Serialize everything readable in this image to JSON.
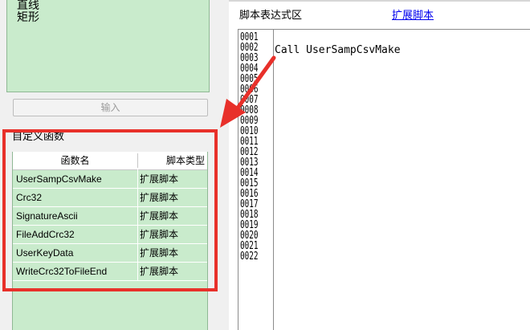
{
  "shape_list": {
    "items": [
      "直线",
      "矩形"
    ]
  },
  "input_button": {
    "label": "输入"
  },
  "custom_functions": {
    "group_label": "自定义函数",
    "columns": [
      "函数名",
      "脚本类型"
    ],
    "rows": [
      {
        "name": "UserSampCsvMake",
        "type": "扩展脚本"
      },
      {
        "name": "Crc32",
        "type": "扩展脚本"
      },
      {
        "name": "SignatureAscii",
        "type": "扩展脚本"
      },
      {
        "name": "FileAddCrc32",
        "type": "扩展脚本"
      },
      {
        "name": "UserKeyData",
        "type": "扩展脚本"
      },
      {
        "name": "WriteCrc32ToFileEnd",
        "type": "扩展脚本"
      }
    ]
  },
  "editor": {
    "label": "脚本表达式区",
    "link": "扩展脚本",
    "line_numbers": [
      "0001",
      "0002",
      "0003",
      "0004",
      "0005",
      "0006",
      "0007",
      "0008",
      "0009",
      "0010",
      "0011",
      "0012",
      "0013",
      "0014",
      "0015",
      "0016",
      "0017",
      "0018",
      "0019",
      "0020",
      "0021",
      "0022"
    ],
    "code_line": "Call UserSampCsvMake"
  },
  "colors": {
    "list_bg": "#c9ebcc",
    "highlight_box": "#e8302a",
    "link": "#0000ee"
  },
  "icons": {
    "annotation": "red-arrow-icon"
  }
}
